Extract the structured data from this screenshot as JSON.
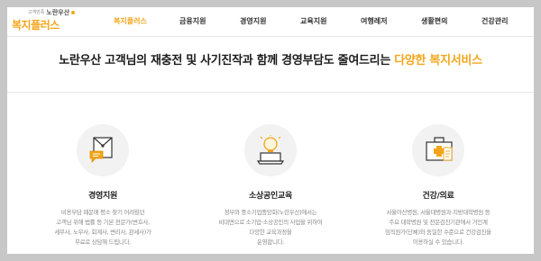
{
  "header": {
    "logo_sub_prefix": "고객만족",
    "logo_sub_brand": "노란우산",
    "logo_main": "복지플러스",
    "nav": [
      {
        "label": "복지플러스",
        "active": true
      },
      {
        "label": "금융지원",
        "active": false
      },
      {
        "label": "경영지원",
        "active": false
      },
      {
        "label": "교육지원",
        "active": false
      },
      {
        "label": "여행레저",
        "active": false
      },
      {
        "label": "생활편의",
        "active": false
      },
      {
        "label": "건강관리",
        "active": false
      }
    ]
  },
  "hero": {
    "text": "노란우산 고객님의 재충전 및 사기진작과 함께 경영부담도 줄여드리는 ",
    "accent": "다양한 복지서비스"
  },
  "cards": [
    {
      "icon": "document-chat-icon",
      "title": "경영지원",
      "description": "비용부담 때문에 평소 찾기 어려웠던\n고객님 위해 법률 등 기본 전문가(변호사,\n세무사, 노무사, 회계사, 변리사, 관세사)가\n무료로 상담해 드립니다."
    },
    {
      "icon": "lightbulb-laptop-icon",
      "title": "소상공인교육",
      "description": "정부와 중소기업중앙회(노란우산)에서는\n비대면으로 소기업·소상공인의 사업을 위하여\n다양한 교육과정을\n운영합니다."
    },
    {
      "icon": "medical-kit-icon",
      "title": "건강/의료",
      "description": "서울아산병원, 서울대병원과 지방대학병원 등\n주요 대학병원 및 전문검진기관에서 거인계\n임직원가(단체)와 동일한 수준으로 건강검진을\n이용하실 수 있습니다."
    }
  ],
  "colors": {
    "accent": "#f3a51a",
    "text_dark": "#1b1b1b",
    "text_muted": "#8a8a8a",
    "frame": "#c7c7c7"
  }
}
